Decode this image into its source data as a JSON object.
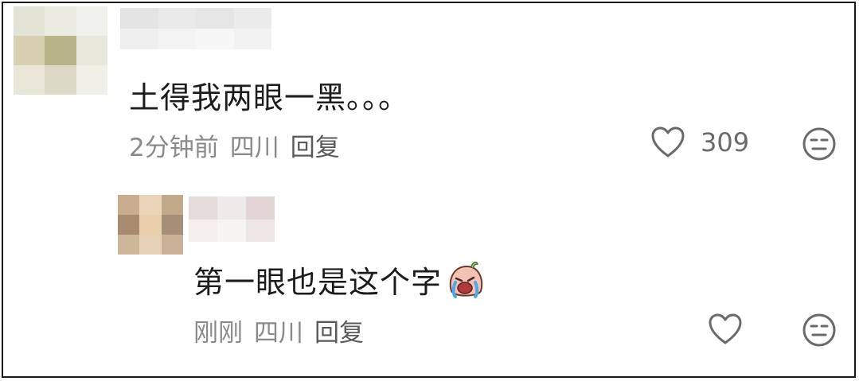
{
  "comments": [
    {
      "text": "土得我两眼一黑。。。",
      "time": "2分钟前",
      "location": "四川",
      "reply_label": "回复",
      "like_count": "309",
      "like_icon": "heart-outline-icon",
      "react_icon": "neutral-face-icon"
    },
    {
      "text": "第一眼也是这个字",
      "emoji": "crying-laughing-sticker",
      "time": "刚刚",
      "location": "四川",
      "reply_label": "回复",
      "like_icon": "heart-outline-icon",
      "react_icon": "neutral-face-icon"
    }
  ],
  "colors": {
    "text": "#1c1c1c",
    "meta": "#8a8a8a",
    "border": "#1a1a1a"
  }
}
